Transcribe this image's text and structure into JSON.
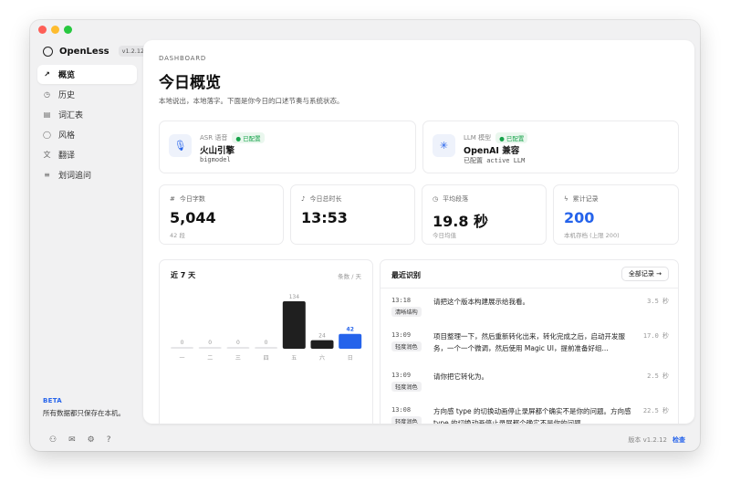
{
  "app": {
    "name": "OpenLess",
    "version_badge": "v1.2.12"
  },
  "sidebar": {
    "items": [
      {
        "label": "概览",
        "icon": "trend-icon",
        "glyph": "↗",
        "active": true
      },
      {
        "label": "历史",
        "icon": "clock-icon",
        "glyph": "◷",
        "active": false
      },
      {
        "label": "词汇表",
        "icon": "book-icon",
        "glyph": "▤",
        "active": false
      },
      {
        "label": "风格",
        "icon": "style-icon",
        "glyph": "◯",
        "active": false
      },
      {
        "label": "翻译",
        "icon": "translate-icon",
        "glyph": "文",
        "active": false
      },
      {
        "label": "划词追问",
        "icon": "selection-icon",
        "glyph": "≡",
        "active": false
      }
    ],
    "beta_title": "BETA",
    "beta_text": "所有数据都只保存在本机。",
    "footer_version": "版本 v1.2.12",
    "footer_check": "检查"
  },
  "header": {
    "eyebrow": "DASHBOARD",
    "title": "今日概览",
    "subtitle": "本地说出，本地落字。下面是你今日的口述节奏与系统状态。"
  },
  "engines": {
    "asr": {
      "label": "ASR 语音",
      "status": "已配置",
      "name": "火山引擎",
      "meta": "bigmodel",
      "icon": "microphone-icon",
      "glyph": "🎙"
    },
    "llm": {
      "label": "LLM 模型",
      "status": "已配置",
      "name": "OpenAI 兼容",
      "meta": "已配置 active LLM",
      "icon": "sparkle-icon",
      "glyph": "✳"
    }
  },
  "stats": [
    {
      "label": "今日字数",
      "icon": "hash-icon",
      "glyph": "#",
      "value": "5,044",
      "foot": "42 段",
      "accent": false
    },
    {
      "label": "今日总时长",
      "icon": "mic-small-icon",
      "glyph": "♪",
      "value": "13:53",
      "foot": "",
      "accent": false
    },
    {
      "label": "平均段落",
      "icon": "clock-small-icon",
      "glyph": "◷",
      "value": "19.8 秒",
      "foot": "今日均值",
      "accent": false
    },
    {
      "label": "累计记录",
      "icon": "activity-icon",
      "glyph": "ϟ",
      "value": "200",
      "foot": "本机存档 (上限 200)",
      "accent": true
    }
  ],
  "colors": {
    "accent": "#2563eb",
    "bar_dark": "#1f1f1f",
    "bar_today": "#2563eb",
    "bar_empty": "#e6e6e8"
  },
  "chart_data": {
    "type": "bar",
    "title": "近 7 天",
    "unit_label": "条数 / 天",
    "categories": [
      "一",
      "二",
      "三",
      "四",
      "五",
      "六",
      "日"
    ],
    "values": [
      0,
      0,
      0,
      0,
      134,
      24,
      42
    ],
    "highlight_index": 6
  },
  "recent": {
    "title": "最近识别",
    "all_button": "全部记录 →",
    "rows": [
      {
        "time": "13:18",
        "tag": "清晰结构",
        "text": "请把这个版本构建展示给我看。",
        "dur": "3.5 秒"
      },
      {
        "time": "13:09",
        "tag": "轻度润色",
        "text": "项目整理一下，然后重新转化出来，转化完成之后，启动开发服务，一个一个微调，然后使用 Magic UI，提前准备好组...",
        "dur": "17.0 秒"
      },
      {
        "time": "13:09",
        "tag": "轻度润色",
        "text": "请你把它转化为。",
        "dur": "2.5 秒"
      },
      {
        "time": "13:08",
        "tag": "轻度润色",
        "text": "方向感 type 的切换动画停止录屏都个确实不是你的问题。方向感 type 的切换动画停止录屏都个确实不是你的问题。",
        "dur": "22.5 秒"
      }
    ]
  }
}
